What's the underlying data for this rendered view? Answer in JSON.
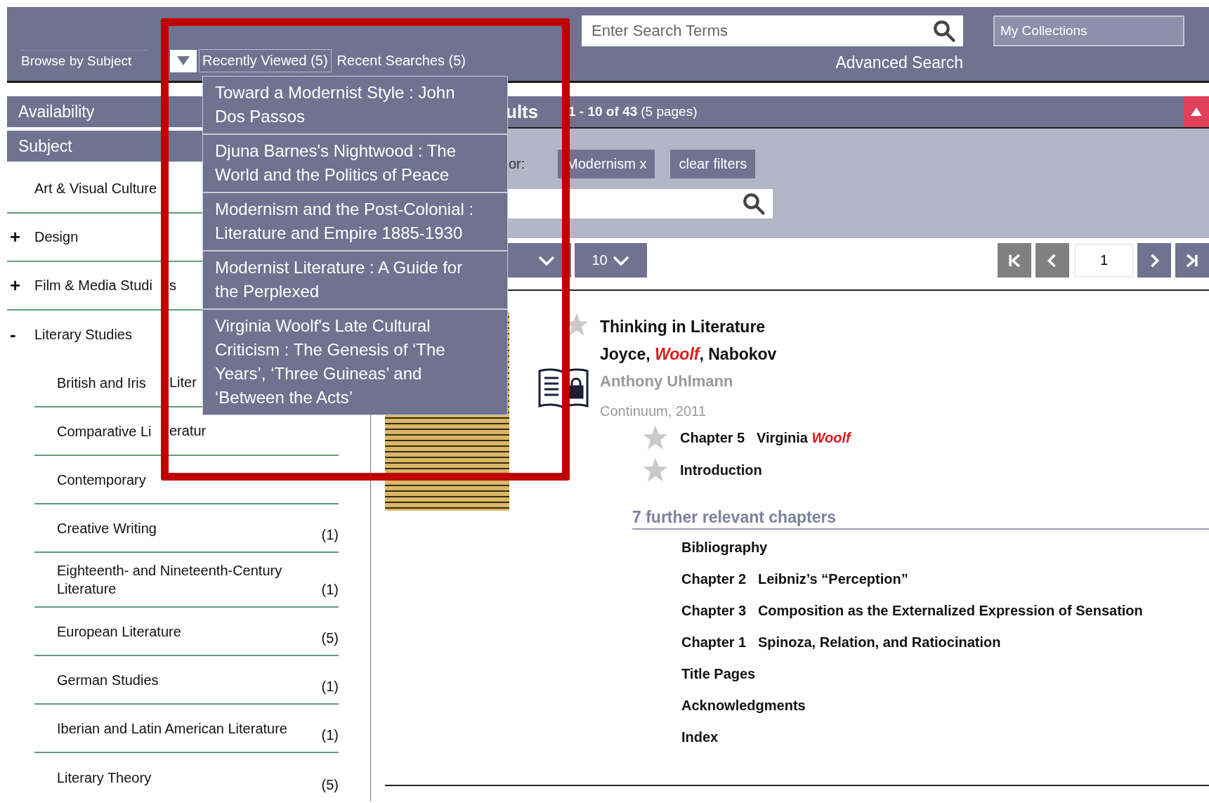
{
  "top_nav": {
    "browse_link": "Browse by Subject",
    "recently_viewed": {
      "label": "Recently Viewed (5)",
      "expanded": true,
      "items": [
        {
          "title": "Toward a Modernist Style : John Dos Passos"
        },
        {
          "title": "Djuna Barnes's Nightwood : The World and the Politics of Peace"
        },
        {
          "title": "Modernism and the Post-Colonial : Literature and Empire 1885-1930"
        },
        {
          "title": "Modernist Literature : A Guide for the Perplexed"
        },
        {
          "title": "Virginia Woolf's Late Cultural Criticism : The Genesis of ‘The Years’, ‘Three Guineas’ and ‘Between the Acts’"
        }
      ]
    },
    "recent_searches": "Recent Searches (5)"
  },
  "search": {
    "placeholder": "Enter Search Terms",
    "advanced_link": "Advanced Search"
  },
  "collections": {
    "placeholder": "My Collections"
  },
  "sidebar": {
    "sections": [
      {
        "title": "Availability"
      },
      {
        "title": "Subject"
      }
    ],
    "subjects": [
      {
        "label": "Art & Visual Culture"
      },
      {
        "label": "Design",
        "toggle": "+"
      },
      {
        "label": "Film & Media Studi",
        "tail": "s",
        "toggle": "+"
      },
      {
        "label": "Literary Studies",
        "toggle": "-",
        "children": [
          {
            "label": "British and Iris",
            "tail": "Liter"
          },
          {
            "label": "Comparative Li",
            "tail": "eratur"
          },
          {
            "label": "Contemporary"
          },
          {
            "label": "Creative Writing",
            "count": "(1)"
          },
          {
            "label": "Eighteenth- and Nineteenth-Century Literature",
            "count": "(1)"
          },
          {
            "label": "European Literature",
            "count": "(5)"
          },
          {
            "label": "German Studies",
            "count": "(1)"
          },
          {
            "label": "Iberian and Latin American Literature",
            "count": "(1)"
          },
          {
            "label": "Literary Theory",
            "count": "(5)"
          }
        ]
      }
    ]
  },
  "results": {
    "heading": "ults",
    "range": "1 - 10 of 43",
    "pages": "(5 pages)",
    "filters": {
      "label": "or:",
      "chips": [
        {
          "label": "Modernism x"
        }
      ],
      "clear": "clear filters"
    },
    "per_page": "10",
    "pager": {
      "page": "1",
      "buttons": [
        {
          "kind": "first",
          "disabled": true
        },
        {
          "kind": "prev",
          "disabled": true
        },
        {
          "kind": "next",
          "disabled": false
        },
        {
          "kind": "last",
          "disabled": false
        }
      ]
    },
    "items": [
      {
        "title": "Thinking in Literature",
        "subtitle": "Joyce, *Woolf*, Nabokov",
        "author": "Anthony Uhlmann",
        "publisher": "Continuum, 2011",
        "matching_chapters": [
          {
            "number": "Chapter 5",
            "title": "Virginia *Woolf*"
          },
          {
            "title": "Introduction"
          }
        ],
        "further_heading": "7 further relevant chapters",
        "further_chapters": [
          {
            "title": "Bibliography"
          },
          {
            "number": "Chapter 2",
            "title": "Leibniz’s “Perception”"
          },
          {
            "number": "Chapter 3",
            "title": "Composition as the Externalized Expression of Sensation"
          },
          {
            "number": "Chapter 1",
            "title": "Spinoza, Relation, and Ratiocination"
          },
          {
            "title": "Title Pages"
          },
          {
            "title": "Acknowledgments"
          },
          {
            "title": "Index"
          }
        ]
      }
    ]
  }
}
